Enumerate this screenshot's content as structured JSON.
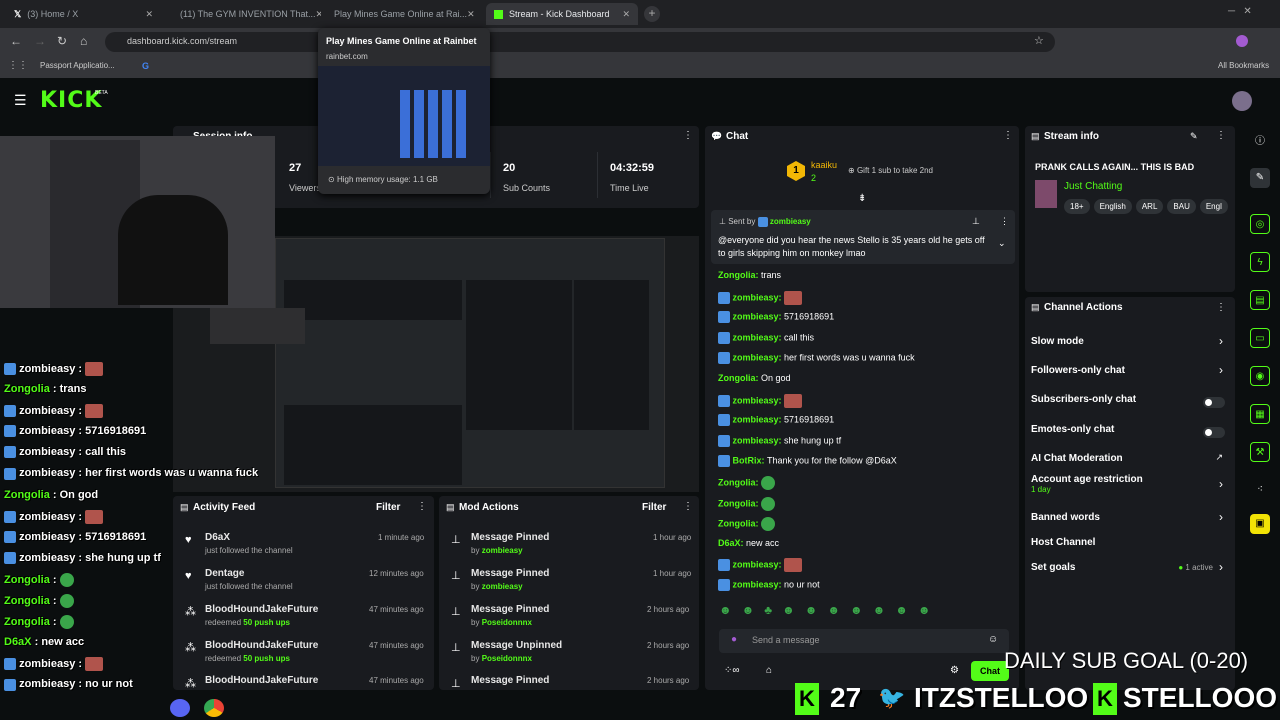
{
  "tabs": [
    {
      "label": "(3) Home / X"
    },
    {
      "label": "(11) The GYM INVENTION That..."
    },
    {
      "label": "Play Mines Game Online at Rai..."
    },
    {
      "label": "Stream - Kick Dashboard"
    }
  ],
  "address": {
    "url": "dashboard.kick.com/stream"
  },
  "bookmarks": {
    "item1": "Passport Applicatio...",
    "all": "All Bookmarks"
  },
  "tooltip": {
    "title": "Play Mines Game Online at Rainbet",
    "domain": "rainbet.com",
    "memory": "High memory usage: 1.1 GB"
  },
  "header": {
    "logo": "KICK",
    "beta": "BETA"
  },
  "session": {
    "title": "Session info",
    "s1_value": "27",
    "s1_label": "Viewers",
    "s2_value": "20",
    "s2_label": "Sub Counts",
    "s3_value": "04:32:59",
    "s3_label": "Time Live"
  },
  "activity": {
    "title": "Activity Feed",
    "filter": "Filter",
    "items": [
      {
        "name": "D6aX",
        "desc": "just followed the channel",
        "time": "1 minute ago"
      },
      {
        "name": "Dentage",
        "desc": "just followed the channel",
        "time": "12 minutes ago"
      },
      {
        "name": "BloodHoundJakeFuture",
        "desc": "redeemed",
        "extra": "50 push ups",
        "time": "47 minutes ago"
      },
      {
        "name": "BloodHoundJakeFuture",
        "desc": "redeemed",
        "extra": "50 push ups",
        "time": "47 minutes ago"
      },
      {
        "name": "BloodHoundJakeFuture",
        "desc": "",
        "extra": "",
        "time": "47 minutes ago"
      }
    ]
  },
  "mod": {
    "title": "Mod Actions",
    "filter": "Filter",
    "items": [
      {
        "action": "Message Pinned",
        "by": "by",
        "who": "zombieasy",
        "time": "1 hour ago"
      },
      {
        "action": "Message Pinned",
        "by": "by",
        "who": "zombieasy",
        "time": "1 hour ago"
      },
      {
        "action": "Message Pinned",
        "by": "by",
        "who": "Poseidonnnx",
        "time": "2 hours ago"
      },
      {
        "action": "Message Unpinned",
        "by": "by",
        "who": "Poseidonnnx",
        "time": "2 hours ago"
      },
      {
        "action": "Message Pinned",
        "by": "",
        "who": "",
        "time": "2 hours ago"
      }
    ]
  },
  "chat": {
    "title": "Chat",
    "gifter": "kaaiku",
    "gifter_count": "2",
    "gift_note": "Gift 1 sub to take 2nd",
    "pinned_sent": "Sent by",
    "pinned_user": "zombieasy",
    "pinned_text": "@everyone did you hear the news Stello is 35 years old he gets off to girls skipping him on monkey lmao",
    "messages": [
      {
        "user": "Zongolia",
        "text": "trans"
      },
      {
        "user": "zombieasy",
        "text": ""
      },
      {
        "user": "zombieasy",
        "text": "5716918691"
      },
      {
        "user": "zombieasy",
        "text": "call this"
      },
      {
        "user": "zombieasy",
        "text": "her first words was u wanna fuck"
      },
      {
        "user": "Zongolia",
        "text": "On god"
      },
      {
        "user": "zombieasy",
        "text": ""
      },
      {
        "user": "zombieasy",
        "text": "5716918691"
      },
      {
        "user": "zombieasy",
        "text": "she hung up tf"
      },
      {
        "user": "BotRix",
        "text": "Thank you for the follow @D6aX"
      },
      {
        "user": "Zongolia",
        "text": ""
      },
      {
        "user": "Zongolia",
        "text": ""
      },
      {
        "user": "Zongolia",
        "text": ""
      },
      {
        "user": "D6aX",
        "text": "new acc"
      },
      {
        "user": "zombieasy",
        "text": ""
      },
      {
        "user": "zombieasy",
        "text": "no ur not"
      }
    ],
    "placeholder": "Send a message",
    "send": "Chat"
  },
  "stream_info": {
    "title": "Stream info",
    "stream_title": "PRANK CALLS AGAIN... THIS IS BAD",
    "category": "Just Chatting",
    "tags": [
      "18+",
      "English",
      "ARL",
      "BAU",
      "Engl"
    ]
  },
  "actions": {
    "title": "Channel Actions",
    "items": [
      {
        "label": "Slow mode",
        "control": "chevron"
      },
      {
        "label": "Followers-only chat",
        "control": "chevron"
      },
      {
        "label": "Subscribers-only chat",
        "control": "toggle"
      },
      {
        "label": "Emotes-only chat",
        "control": "toggle"
      },
      {
        "label": "AI Chat Moderation",
        "control": "external"
      },
      {
        "label": "Account age restriction",
        "sub": "1 day",
        "control": "chevron"
      },
      {
        "label": "Banned words",
        "control": "chevron"
      },
      {
        "label": "Host Channel",
        "control": "none"
      },
      {
        "label": "Set goals",
        "sub": "1 active",
        "control": "chevron"
      }
    ]
  },
  "overlay": {
    "chat": [
      {
        "user": "zombieasy",
        "text": ""
      },
      {
        "user": "Zongolia",
        "text": "trans"
      },
      {
        "user": "zombieasy",
        "text": ""
      },
      {
        "user": "zombieasy",
        "text": "5716918691"
      },
      {
        "user": "zombieasy",
        "text": "call this"
      },
      {
        "user": "zombieasy",
        "text": "her first words was u wanna fuck"
      },
      {
        "user": "Zongolia",
        "text": "On god"
      },
      {
        "user": "zombieasy",
        "text": ""
      },
      {
        "user": "zombieasy",
        "text": "5716918691"
      },
      {
        "user": "zombieasy",
        "text": "she hung up tf"
      },
      {
        "user": "Zongolia",
        "text": ""
      },
      {
        "user": "Zongolia",
        "text": ""
      },
      {
        "user": "Zongolia",
        "text": ""
      },
      {
        "user": "D6aX",
        "text": "new acc"
      },
      {
        "user": "zombieasy",
        "text": ""
      },
      {
        "user": "zombieasy",
        "text": "no ur not"
      }
    ],
    "goal": "DAILY SUB GOAL (0-20)",
    "count": "27",
    "twitter": "ITZSTELLOO",
    "kick": "STELLOOO"
  },
  "colors": {
    "accent": "#53fc18",
    "panel": "#191b1f",
    "bg": "#0b0e0f"
  }
}
